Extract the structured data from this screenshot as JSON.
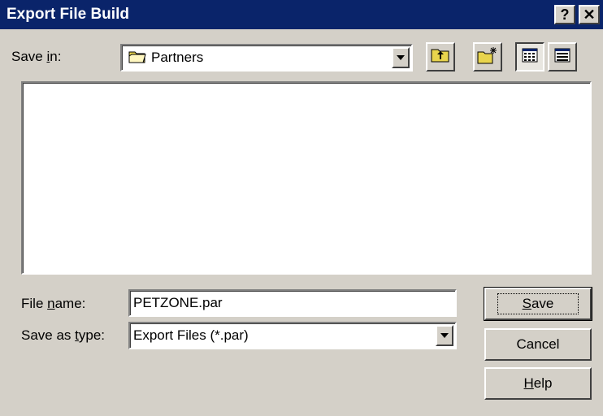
{
  "window": {
    "title": "Export File Build",
    "help_glyph": "?",
    "close_glyph": "✕"
  },
  "save_in": {
    "label_pre": "Save ",
    "label_key": "i",
    "label_post": "n:",
    "value": "Partners"
  },
  "toolbar": {
    "icons": [
      "up-one-level-icon",
      "create-new-folder-icon",
      "list-view-icon",
      "details-view-icon"
    ]
  },
  "file_name": {
    "label_pre": "File ",
    "label_key": "n",
    "label_post": "ame:",
    "value": "PETZONE.par"
  },
  "save_as_type": {
    "label_pre": "Save as ",
    "label_key": "t",
    "label_post": "ype:",
    "value": "Export Files (*.par)"
  },
  "buttons": {
    "save_key": "S",
    "save_rest": "ave",
    "cancel": "Cancel",
    "help_key": "H",
    "help_rest": "elp"
  }
}
